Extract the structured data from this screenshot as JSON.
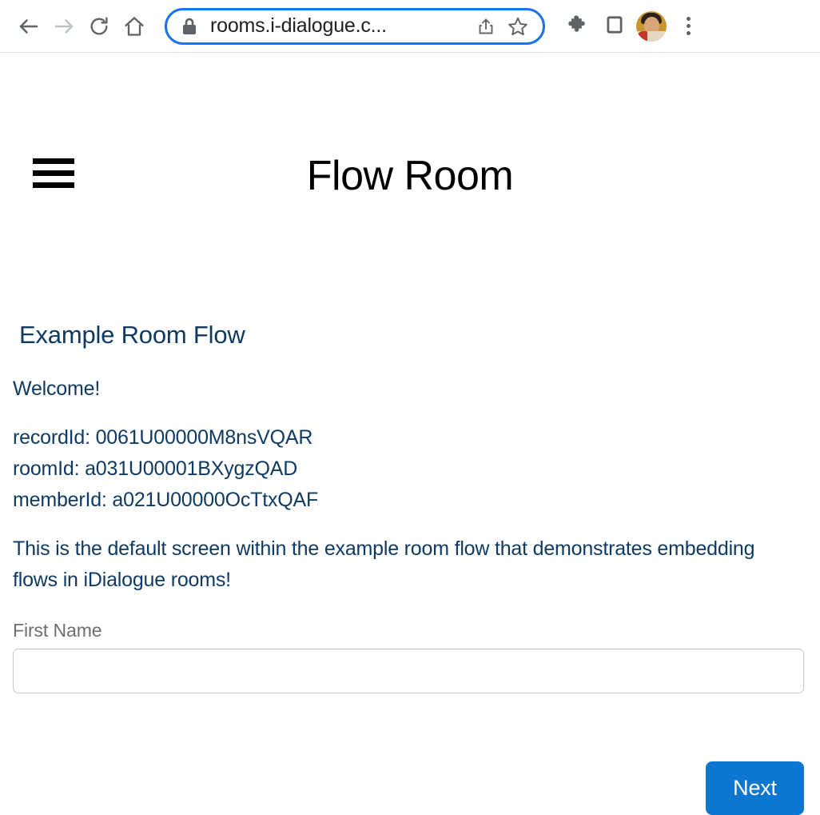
{
  "browser": {
    "back_label": "Back",
    "forward_label": "Forward",
    "reload_label": "Reload",
    "home_label": "Home",
    "url_text": "rooms.i-dialogue.c...",
    "share_label": "Share",
    "bookmark_label": "Bookmark this tab",
    "extensions_label": "Extensions",
    "side_panel_label": "Side panel",
    "profile_label": "Profile",
    "menu_label": "Customize and control Google Chrome",
    "accent_color": "#1a73e8",
    "icon_color": "#5f6368",
    "forward_disabled_color": "#bdc1c6"
  },
  "app": {
    "menu_label": "Menu",
    "title": "Flow Room"
  },
  "flow": {
    "heading": "Example Room Flow",
    "welcome": "Welcome!",
    "record_id_line": "recordId: 0061U00000M8nsVQAR",
    "room_id_line": "roomId: a031U00001BXygzQAD",
    "member_id_line": "memberId: a021U00000OcTtxQAF",
    "description": "This is the default screen within the example room flow that demonstrates embedding flows in iDialogue rooms!",
    "text_color": "#0f3a63",
    "field": {
      "label": "First Name",
      "value": "",
      "placeholder": ""
    },
    "next_label": "Next",
    "next_color": "#0d76d1"
  }
}
